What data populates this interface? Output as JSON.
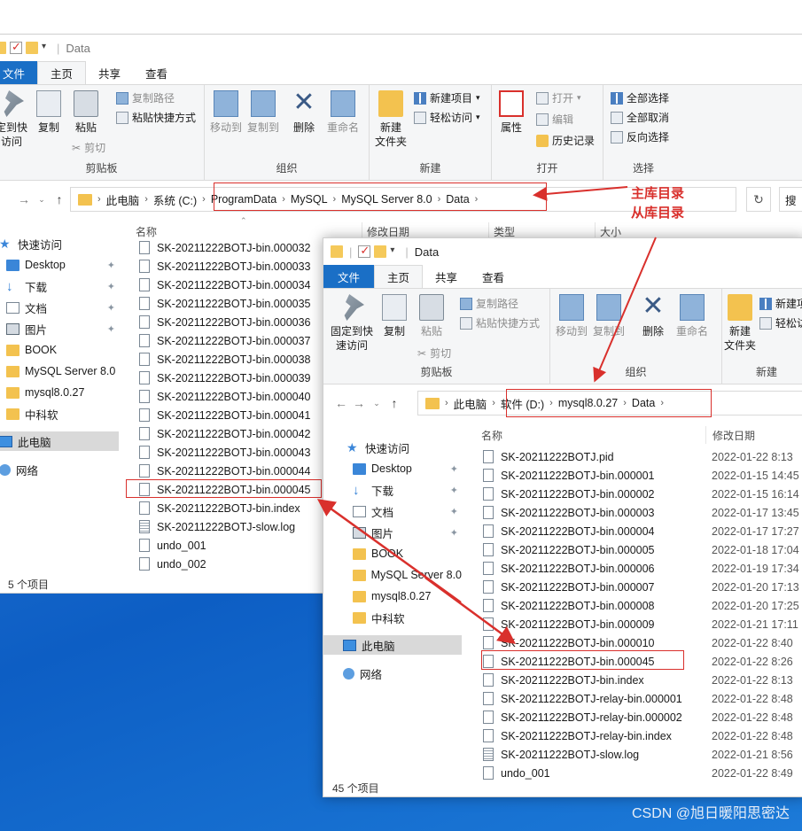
{
  "window_back": {
    "title": "Data",
    "menu": {
      "file": "文件",
      "home": "主页",
      "share": "共享",
      "view": "查看"
    },
    "ribbon": {
      "pin_label": "固定到快\n速访问",
      "copy": "复制",
      "paste": "粘贴",
      "copy_path": "复制路径",
      "paste_shortcut": "粘贴快捷方式",
      "cut": "剪切",
      "clipboard": "剪贴板",
      "move_to": "移动到",
      "copy_to": "复制到",
      "delete": "删除",
      "rename": "重命名",
      "organize": "组织",
      "new_folder": "新建\n文件夹",
      "new_item": "新建项目",
      "easy_access": "轻松访问",
      "new": "新建",
      "properties": "属性",
      "open": "打开",
      "edit": "编辑",
      "history": "历史记录",
      "open_group": "打开",
      "select_all": "全部选择",
      "select_none": "全部取消",
      "invert": "反向选择",
      "select_group": "选择"
    },
    "address": [
      "此电脑",
      "系统 (C:)",
      "ProgramData",
      "MySQL",
      "MySQL Server 8.0",
      "Data"
    ],
    "search_placeholder": "搜",
    "columns": {
      "name": "名称",
      "modified": "修改日期",
      "type": "类型",
      "size": "大小"
    },
    "nav": {
      "quick_access": "快速访问",
      "desktop": "Desktop",
      "downloads": "下载",
      "documents": "文档",
      "pictures": "图片",
      "book": "BOOK",
      "mysql_server": "MySQL Server 8.0",
      "mysql8": "mysql8.0.27",
      "zky": "中科软",
      "this_pc": "此电脑",
      "network": "网络"
    },
    "files": [
      "SK-20211222BOTJ-bin.000032",
      "SK-20211222BOTJ-bin.000033",
      "SK-20211222BOTJ-bin.000034",
      "SK-20211222BOTJ-bin.000035",
      "SK-20211222BOTJ-bin.000036",
      "SK-20211222BOTJ-bin.000037",
      "SK-20211222BOTJ-bin.000038",
      "SK-20211222BOTJ-bin.000039",
      "SK-20211222BOTJ-bin.000040",
      "SK-20211222BOTJ-bin.000041",
      "SK-20211222BOTJ-bin.000042",
      "SK-20211222BOTJ-bin.000043",
      "SK-20211222BOTJ-bin.000044",
      "SK-20211222BOTJ-bin.000045",
      "SK-20211222BOTJ-bin.index",
      "SK-20211222BOTJ-slow.log",
      "undo_001",
      "undo_002"
    ],
    "status": "5 个项目"
  },
  "window_front": {
    "title": "Data",
    "menu": {
      "file": "文件",
      "home": "主页",
      "share": "共享",
      "view": "查看"
    },
    "ribbon": {
      "pin_label": "固定到快\n速访问",
      "copy": "复制",
      "paste": "粘贴",
      "copy_path": "复制路径",
      "paste_shortcut": "粘贴快捷方式",
      "cut": "剪切",
      "clipboard": "剪贴板",
      "move_to": "移动到",
      "copy_to": "复制到",
      "delete": "删除",
      "rename": "重命名",
      "organize": "组织",
      "new_folder": "新建\n文件夹",
      "new_item": "新建项",
      "easy_access": "轻松访",
      "new": "新建"
    },
    "address": [
      "此电脑",
      "软件 (D:)",
      "mysql8.0.27",
      "Data"
    ],
    "columns": {
      "name": "名称",
      "modified": "修改日期"
    },
    "nav": {
      "quick_access": "快速访问",
      "desktop": "Desktop",
      "downloads": "下载",
      "documents": "文档",
      "pictures": "图片",
      "book": "BOOK",
      "mysql_server": "MySQL Server 8.0",
      "mysql8": "mysql8.0.27",
      "zky": "中科软",
      "this_pc": "此电脑",
      "network": "网络"
    },
    "files": [
      {
        "name": "SK-20211222BOTJ.pid",
        "date": "2022-01-22 8:13"
      },
      {
        "name": "SK-20211222BOTJ-bin.000001",
        "date": "2022-01-15 14:45"
      },
      {
        "name": "SK-20211222BOTJ-bin.000002",
        "date": "2022-01-15 16:14"
      },
      {
        "name": "SK-20211222BOTJ-bin.000003",
        "date": "2022-01-17 13:45"
      },
      {
        "name": "SK-20211222BOTJ-bin.000004",
        "date": "2022-01-17 17:27"
      },
      {
        "name": "SK-20211222BOTJ-bin.000005",
        "date": "2022-01-18 17:04"
      },
      {
        "name": "SK-20211222BOTJ-bin.000006",
        "date": "2022-01-19 17:34"
      },
      {
        "name": "SK-20211222BOTJ-bin.000007",
        "date": "2022-01-20 17:13"
      },
      {
        "name": "SK-20211222BOTJ-bin.000008",
        "date": "2022-01-20 17:25"
      },
      {
        "name": "SK-20211222BOTJ-bin.000009",
        "date": "2022-01-21 17:11"
      },
      {
        "name": "SK-20211222BOTJ-bin.000010",
        "date": "2022-01-22 8:40"
      },
      {
        "name": "SK-20211222BOTJ-bin.000045",
        "date": "2022-01-22 8:26"
      },
      {
        "name": "SK-20211222BOTJ-bin.index",
        "date": "2022-01-22 8:13"
      },
      {
        "name": "SK-20211222BOTJ-relay-bin.000001",
        "date": "2022-01-22 8:48"
      },
      {
        "name": "SK-20211222BOTJ-relay-bin.000002",
        "date": "2022-01-22 8:48"
      },
      {
        "name": "SK-20211222BOTJ-relay-bin.index",
        "date": "2022-01-22 8:48"
      },
      {
        "name": "SK-20211222BOTJ-slow.log",
        "date": "2022-01-21 8:56"
      },
      {
        "name": "undo_001",
        "date": "2022-01-22 8:49"
      }
    ],
    "status": "45 个项目"
  },
  "annotations": {
    "master": "主库目录",
    "slave": "从库目录"
  },
  "watermark": "CSDN @旭日暖阳思密达",
  "colors": {
    "annotation": "#d9302c",
    "file_tab": "#1a6fc6"
  }
}
